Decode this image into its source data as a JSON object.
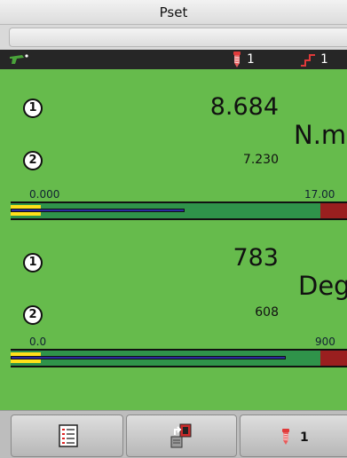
{
  "header": {
    "title": "Pset"
  },
  "status": {
    "screw_count": "1",
    "step_count": "1"
  },
  "torque": {
    "index1": "1",
    "index2": "2",
    "value": "8.684",
    "target": "7.230",
    "unit": "N.m",
    "scale_min": "0.000",
    "scale_max": "17.00"
  },
  "angle": {
    "index1": "1",
    "index2": "2",
    "value": "783",
    "target": "608",
    "unit": "Deg",
    "scale_min": "0.0",
    "scale_max": "900"
  },
  "bottom": {
    "screw_count": "1"
  },
  "colors": {
    "background": "#66bb4c",
    "ok_zone": "#2f934a",
    "high_zone": "#9a1f1f",
    "marker": "#ffe01a",
    "fill": "#2a2a9e"
  }
}
